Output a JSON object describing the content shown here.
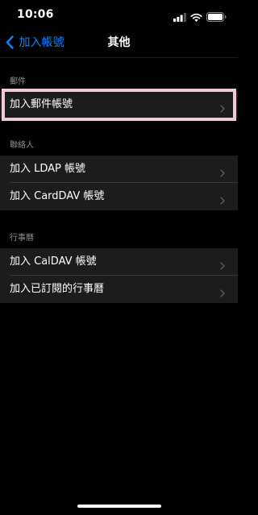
{
  "status_bar": {
    "time": "10:06",
    "icons": [
      "cellular-signal-icon",
      "wifi-icon",
      "battery-icon"
    ]
  },
  "nav": {
    "back_label": "加入帳號",
    "title": "其他",
    "back_icon": "chevron-left-icon"
  },
  "sections": [
    {
      "header": "郵件",
      "items": [
        {
          "label": "加入郵件帳號"
        }
      ]
    },
    {
      "header": "聯絡人",
      "items": [
        {
          "label": "加入 LDAP 帳號"
        },
        {
          "label": "加入 CardDAV 帳號"
        }
      ]
    },
    {
      "header": "行事曆",
      "items": [
        {
          "label": "加入 CalDAV 帳號"
        },
        {
          "label": "加入已訂閱的行事曆"
        }
      ]
    }
  ],
  "colors": {
    "accent": "#0a84ff",
    "row_background": "#1c1c1e",
    "header_text": "#8e8e93",
    "highlight": "#f3c9d2"
  }
}
